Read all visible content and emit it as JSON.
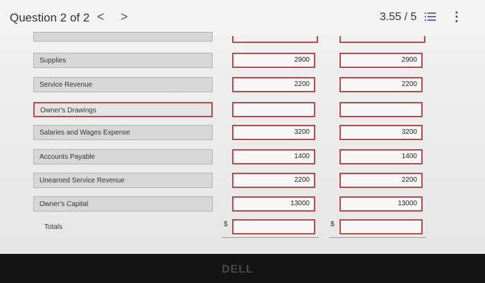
{
  "header": {
    "question_count": "Question 2 of 2",
    "prev_symbol": "<",
    "next_symbol": ">",
    "score": "3.55 / 5"
  },
  "rows": [
    {
      "account": "Supplies",
      "debit": "2900",
      "credit": "2900"
    },
    {
      "account": "Service Revenue",
      "debit": "2200",
      "credit": "2200"
    },
    {
      "account": "Owner's Drawings",
      "debit": "",
      "credit": ""
    },
    {
      "account": "Salaries and Wages Expense",
      "debit": "3200",
      "credit": "3200"
    },
    {
      "account": "Accounts Payable",
      "debit": "1400",
      "credit": "1400"
    },
    {
      "account": "Unearned Service Revenue",
      "debit": "2200",
      "credit": "2200"
    },
    {
      "account": "Owner's Capital",
      "debit": "13000",
      "credit": "13000"
    }
  ],
  "totals": {
    "label": "Totals",
    "currency": "$",
    "debit": "",
    "credit": ""
  },
  "footer": {
    "brand": "DELL"
  },
  "colors": {
    "error_border": "#b74a4a"
  }
}
